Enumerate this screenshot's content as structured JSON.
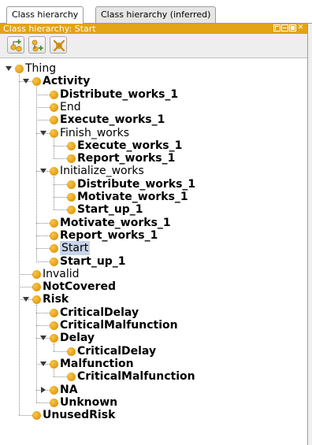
{
  "tabs": [
    {
      "label": "Class hierarchy",
      "active": true
    },
    {
      "label": "Class hierarchy (inferred)",
      "active": false
    }
  ],
  "panel": {
    "title": "Class hierarchy: Start",
    "accent_color": "#e2a415",
    "toolbar": [
      {
        "name": "add-subclass-icon",
        "tooltip": ""
      },
      {
        "name": "add-sibling-class-icon",
        "tooltip": ""
      },
      {
        "name": "delete-class-icon",
        "tooltip": ""
      }
    ]
  },
  "tree": [
    {
      "label": "Thing",
      "bold": false,
      "depth": 0,
      "expanded": true
    },
    {
      "label": "Activity",
      "bold": true,
      "depth": 1,
      "expanded": true
    },
    {
      "label": "Distribute_works_1",
      "bold": true,
      "depth": 2
    },
    {
      "label": "End",
      "bold": false,
      "depth": 2
    },
    {
      "label": "Execute_works_1",
      "bold": true,
      "depth": 2
    },
    {
      "label": "Finish_works",
      "bold": false,
      "depth": 2,
      "expanded": true
    },
    {
      "label": "Execute_works_1",
      "bold": true,
      "depth": 3
    },
    {
      "label": "Report_works_1",
      "bold": true,
      "depth": 3
    },
    {
      "label": "Initialize_works",
      "bold": false,
      "depth": 2,
      "expanded": true
    },
    {
      "label": "Distribute_works_1",
      "bold": true,
      "depth": 3
    },
    {
      "label": "Motivate_works_1",
      "bold": true,
      "depth": 3
    },
    {
      "label": "Start_up_1",
      "bold": true,
      "depth": 3
    },
    {
      "label": "Motivate_works_1",
      "bold": true,
      "depth": 2
    },
    {
      "label": "Report_works_1",
      "bold": true,
      "depth": 2
    },
    {
      "label": "Start",
      "bold": false,
      "depth": 2,
      "selected": true
    },
    {
      "label": "Start_up_1",
      "bold": true,
      "depth": 2
    },
    {
      "label": "Invalid",
      "bold": false,
      "depth": 1
    },
    {
      "label": "NotCovered",
      "bold": true,
      "depth": 1
    },
    {
      "label": "Risk",
      "bold": true,
      "depth": 1,
      "expanded": true
    },
    {
      "label": "CriticalDelay",
      "bold": true,
      "depth": 2
    },
    {
      "label": "CriticalMalfunction",
      "bold": true,
      "depth": 2
    },
    {
      "label": "Delay",
      "bold": true,
      "depth": 2,
      "expanded": true
    },
    {
      "label": "CriticalDelay",
      "bold": true,
      "depth": 3
    },
    {
      "label": "Malfunction",
      "bold": true,
      "depth": 2,
      "expanded": true
    },
    {
      "label": "CriticalMalfunction",
      "bold": true,
      "depth": 3
    },
    {
      "label": "NA",
      "bold": true,
      "depth": 2,
      "expanded": false,
      "has_children": true
    },
    {
      "label": "Unknown",
      "bold": true,
      "depth": 2
    },
    {
      "label": "UnusedRisk",
      "bold": true,
      "depth": 1
    }
  ]
}
